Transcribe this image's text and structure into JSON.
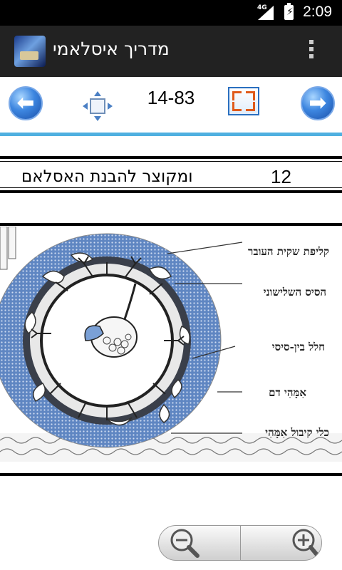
{
  "status_bar": {
    "network": "4G",
    "time": "2:09"
  },
  "app": {
    "title": "מדריך איסלאמי"
  },
  "toolbar": {
    "page_indicator": "14-83"
  },
  "content": {
    "row_number": "12",
    "row_text": "ומקוצר להבנת האסלאם"
  },
  "figure": {
    "labels": [
      "קליפת שקית העובר",
      "הסיס השלישוני",
      "חלל בין-סיסי",
      "אִמָּהִי דם",
      "כלי קיבול אִמָּהִי"
    ]
  },
  "icons": {
    "back": "arrow-left-icon",
    "move": "move-arrows-icon",
    "fullscreen": "fullscreen-icon",
    "forward": "arrow-right-icon",
    "zoom_out": "zoom-out-icon",
    "zoom_in": "zoom-in-icon",
    "overflow": "overflow-menu-icon"
  },
  "colors": {
    "accent": "#4fb0e0",
    "action_bar": "#222222",
    "button_blue": "#3d86e0"
  }
}
